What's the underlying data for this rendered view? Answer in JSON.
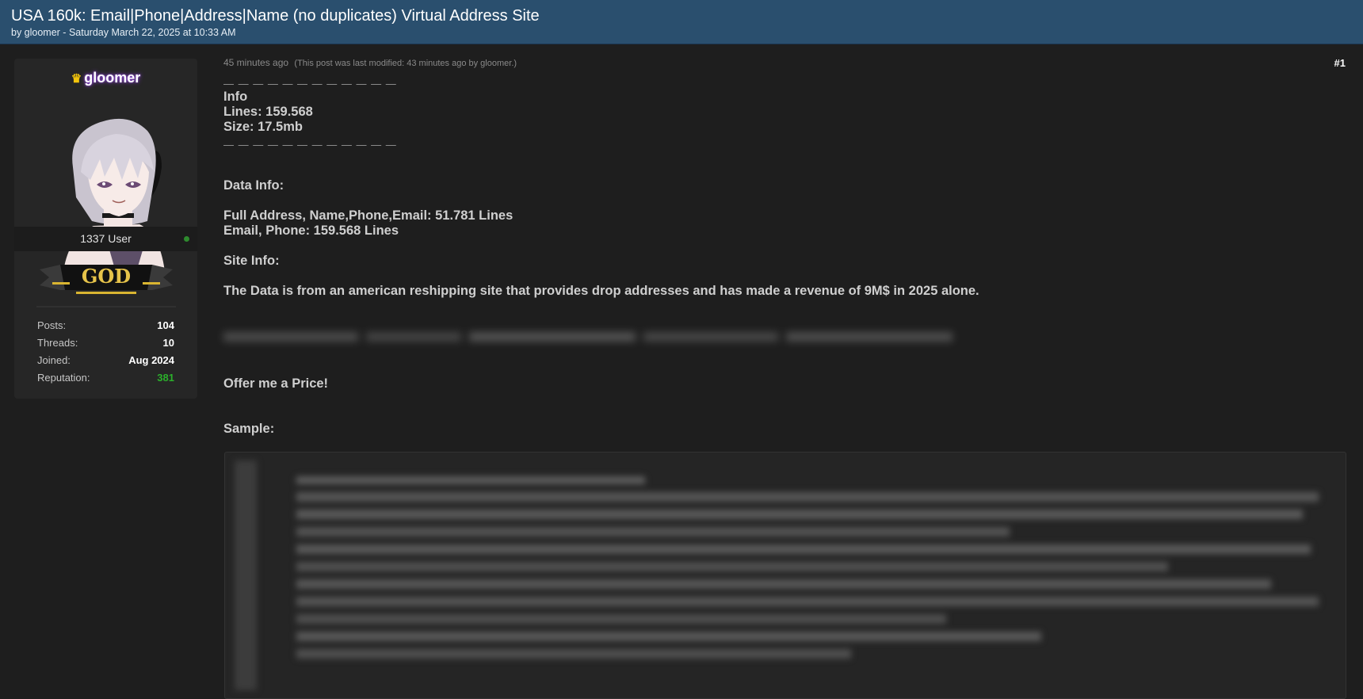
{
  "thread": {
    "title": "USA 160k: Email|Phone|Address|Name (no duplicates) Virtual Address Site",
    "byline": "by gloomer - Saturday March 22, 2025 at 10:33 AM"
  },
  "author": {
    "username": "gloomer",
    "user_title": "1337 User",
    "rank_label": "GOD",
    "status_color": "#2e8a2e",
    "stats": [
      {
        "label": "Posts:",
        "value": "104"
      },
      {
        "label": "Threads:",
        "value": "10"
      },
      {
        "label": "Joined:",
        "value": "Aug 2024"
      },
      {
        "label": "Reputation:",
        "value": "381"
      }
    ]
  },
  "post": {
    "time_ago": "45 minutes ago",
    "modified_note": "(This post was last modified: 43 minutes ago by gloomer.)",
    "number": "#1",
    "separator_top": "— — — — — — — — — — — —",
    "info_heading": "Info",
    "lines": "Lines: 159.568",
    "size": "Size:  17.5mb",
    "separator_bottom": " — — — — — — — — — — — —",
    "data_info_heading": "Data Info:",
    "data_info_1": "Full Address, Name,Phone,Email: 51.781 Lines",
    "data_info_2": "Email, Phone: 159.568 Lines",
    "site_info_heading": "Site Info:",
    "site_info_text": "The Data is from an american reshipping site that provides drop addresses and has made a revenue of 9M$ in 2025 alone.",
    "offer_text": "Offer me a Price!",
    "sample_heading": "Sample:"
  },
  "colors": {
    "header_bg": "#2a4f6e",
    "page_bg": "#1e1e1e",
    "reputation": "#2bb02b",
    "crown": "#f2c40c",
    "username_glow": "#8a3ad6"
  }
}
